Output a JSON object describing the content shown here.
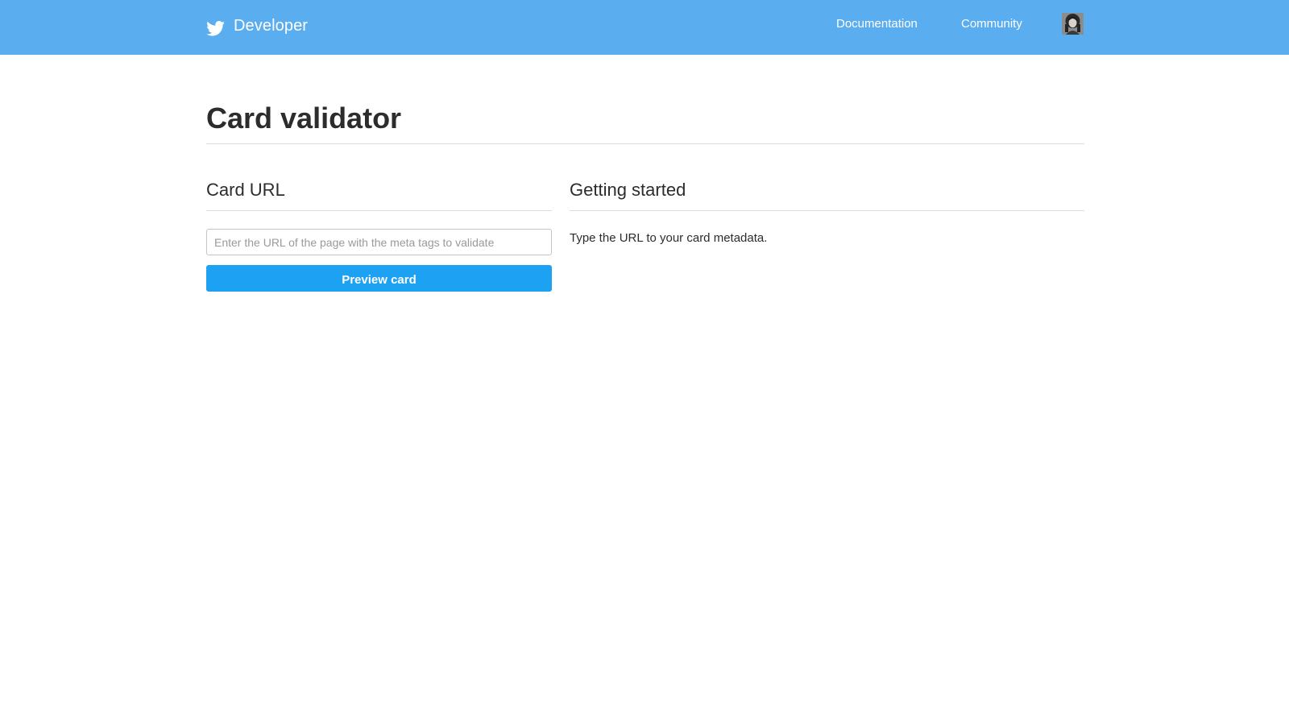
{
  "header": {
    "brand_label": "Developer",
    "brand_icon": "twitter-bird-icon",
    "nav": {
      "documentation": "Documentation",
      "community": "Community"
    },
    "avatar_icon": "user-avatar",
    "background_color": "#5aadef"
  },
  "page": {
    "title": "Card validator"
  },
  "card_url": {
    "heading": "Card URL",
    "input_value": "",
    "input_placeholder": "Enter the URL of the page with the meta tags to validate",
    "button_label": "Preview card",
    "button_color": "#1da1f2"
  },
  "getting_started": {
    "heading": "Getting started",
    "text": "Type the URL to your card metadata."
  }
}
